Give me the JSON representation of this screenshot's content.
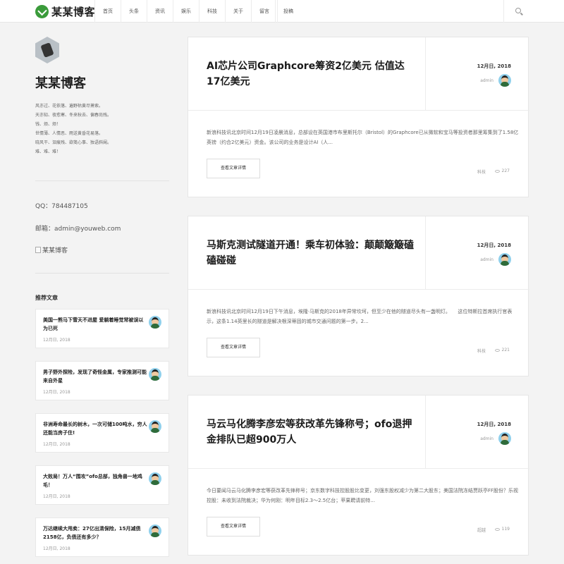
{
  "header": {
    "logo_text": "某某博客",
    "nav": [
      "首页",
      "头条",
      "资讯",
      "娱乐",
      "科技",
      "关于",
      "留言"
    ],
    "post_label": "投稿"
  },
  "sidebar": {
    "title": "某某博客",
    "poem": [
      "风亦过、花依落、遍野枯黄尽萧索。",
      "天亦知、夜愈寒、冬来秋去、偏春尚残。",
      "钱、烦、烦！",
      "世情薄、人情恶、雨送黄昏花易落。",
      "晓风干、泪痕残、欲笺心事、独语斜阑。",
      "难、难、难！"
    ],
    "qq": "QQ：784487105",
    "email": "邮箱：admin@youweb.com",
    "image_alt": "某某博客",
    "recommend_title": "推荐文章",
    "recommend": [
      {
        "title": "美国一熊马下雪天不进屋 爱躺着睡觉常被误以为已死",
        "date": "12月日, 2018"
      },
      {
        "title": "男子野外探险，发现了奇怪金属，专家推测可能来自外星",
        "date": "12月日, 2018"
      },
      {
        "title": "非洲寿命最长的树木，一次可储100吨水，穷人还能当房子住!",
        "date": "12月日, 2018"
      },
      {
        "title": "大败局！万人“围攻”ofo总部，独角兽一地鸡毛！",
        "date": "12月日, 2018"
      },
      {
        "title": "万达继续大甩卖：27亿出清保险，15月减债2158亿，负债还有多少？",
        "date": "12月日, 2018"
      }
    ]
  },
  "articles": [
    {
      "title": "AI芯片公司Graphcore筹资2亿美元 估值达17亿美元",
      "date": "12月日, 2018",
      "author": "admin",
      "excerpt": "新浪科技讯北京时间12月19日凌晨消息，总部设在英国港市布里斯托尔（Bristol）的Graphcore已从微软和宝马等投资者那里筹集到了1.58亿英镑（约合2亿美元）资金。该公司的业务是设计AI（人...",
      "button": "查看文章详情",
      "tag": "科技",
      "views": "227"
    },
    {
      "title": "马斯克测试隧道开通！乘车初体验：颠颠簸簸磕磕碰碰",
      "date": "12月日, 2018",
      "author": "admin",
      "excerpt": "新浪科技讯北京时间12月19日下午消息，埃隆·马斯克的2018年异常坎坷，但至少在他的隧道尽头有一盏明灯。　　这位特斯拉首席执行官表示，这条1.14英里长的隧道是解决根深蒂固的城市交通问题的第一步。2...",
      "button": "查看文章详情",
      "tag": "科技",
      "views": "221"
    },
    {
      "title": "马云马化腾李彦宏等获改革先锋称号；ofo退押金排队已超900万人",
      "date": "12月日, 2018",
      "author": "admin",
      "excerpt": "今日要闻马云马化腾李彦宏等获改革先锋称号；京东数字科技控股股比变更，刘强东股权减少为第二大股东；美国法院冻结贾跃亭FF股份？乐视控股：未收到法院裁决；华为何刚：明年目标2.3～2.5亿台；苹果聘请前特...",
      "button": "查看文章详情",
      "tag": "超越",
      "views": "119"
    }
  ]
}
